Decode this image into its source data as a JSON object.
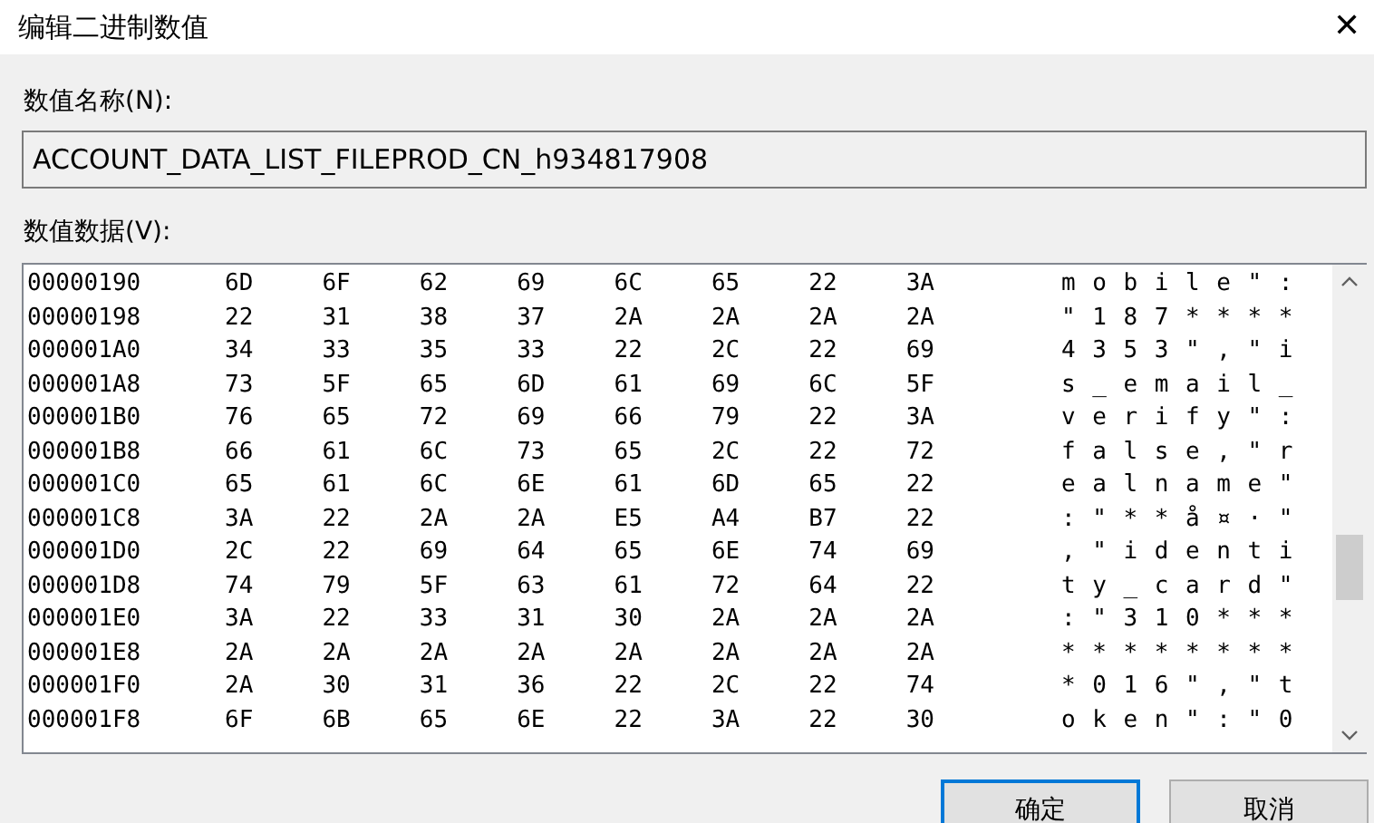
{
  "window": {
    "title": "编辑二进制数值",
    "close": "✕"
  },
  "value_name": {
    "label": "数值名称(N):",
    "value": "ACCOUNT_DATA_LIST_FILEPROD_CN_h934817908"
  },
  "value_data": {
    "label": "数值数据(V):",
    "rows": [
      {
        "address": "00000190",
        "bytes": [
          "6D",
          "6F",
          "62",
          "69",
          "6C",
          "65",
          "22",
          "3A"
        ],
        "ascii": "mobile\":"
      },
      {
        "address": "00000198",
        "bytes": [
          "22",
          "31",
          "38",
          "37",
          "2A",
          "2A",
          "2A",
          "2A"
        ],
        "ascii": "\"187****"
      },
      {
        "address": "000001A0",
        "bytes": [
          "34",
          "33",
          "35",
          "33",
          "22",
          "2C",
          "22",
          "69"
        ],
        "ascii": "4353\",\"i"
      },
      {
        "address": "000001A8",
        "bytes": [
          "73",
          "5F",
          "65",
          "6D",
          "61",
          "69",
          "6C",
          "5F"
        ],
        "ascii": "s_email_"
      },
      {
        "address": "000001B0",
        "bytes": [
          "76",
          "65",
          "72",
          "69",
          "66",
          "79",
          "22",
          "3A"
        ],
        "ascii": "verify\":"
      },
      {
        "address": "000001B8",
        "bytes": [
          "66",
          "61",
          "6C",
          "73",
          "65",
          "2C",
          "22",
          "72"
        ],
        "ascii": "false,\"r"
      },
      {
        "address": "000001C0",
        "bytes": [
          "65",
          "61",
          "6C",
          "6E",
          "61",
          "6D",
          "65",
          "22"
        ],
        "ascii": "ealname\""
      },
      {
        "address": "000001C8",
        "bytes": [
          "3A",
          "22",
          "2A",
          "2A",
          "E5",
          "A4",
          "B7",
          "22"
        ],
        "ascii": ":\"**å¤·\""
      },
      {
        "address": "000001D0",
        "bytes": [
          "2C",
          "22",
          "69",
          "64",
          "65",
          "6E",
          "74",
          "69"
        ],
        "ascii": ",\"identi"
      },
      {
        "address": "000001D8",
        "bytes": [
          "74",
          "79",
          "5F",
          "63",
          "61",
          "72",
          "64",
          "22"
        ],
        "ascii": "ty_card\""
      },
      {
        "address": "000001E0",
        "bytes": [
          "3A",
          "22",
          "33",
          "31",
          "30",
          "2A",
          "2A",
          "2A"
        ],
        "ascii": ":\"310***"
      },
      {
        "address": "000001E8",
        "bytes": [
          "2A",
          "2A",
          "2A",
          "2A",
          "2A",
          "2A",
          "2A",
          "2A"
        ],
        "ascii": "********"
      },
      {
        "address": "000001F0",
        "bytes": [
          "2A",
          "30",
          "31",
          "36",
          "22",
          "2C",
          "22",
          "74"
        ],
        "ascii": "*016\",\"t"
      },
      {
        "address": "000001F8",
        "bytes": [
          "6F",
          "6B",
          "65",
          "6E",
          "22",
          "3A",
          "22",
          "30"
        ],
        "ascii": "oken\":\"0"
      }
    ]
  },
  "buttons": [
    {
      "label": "确定",
      "kind": "default"
    },
    {
      "label": "取消",
      "kind": "normal"
    }
  ]
}
